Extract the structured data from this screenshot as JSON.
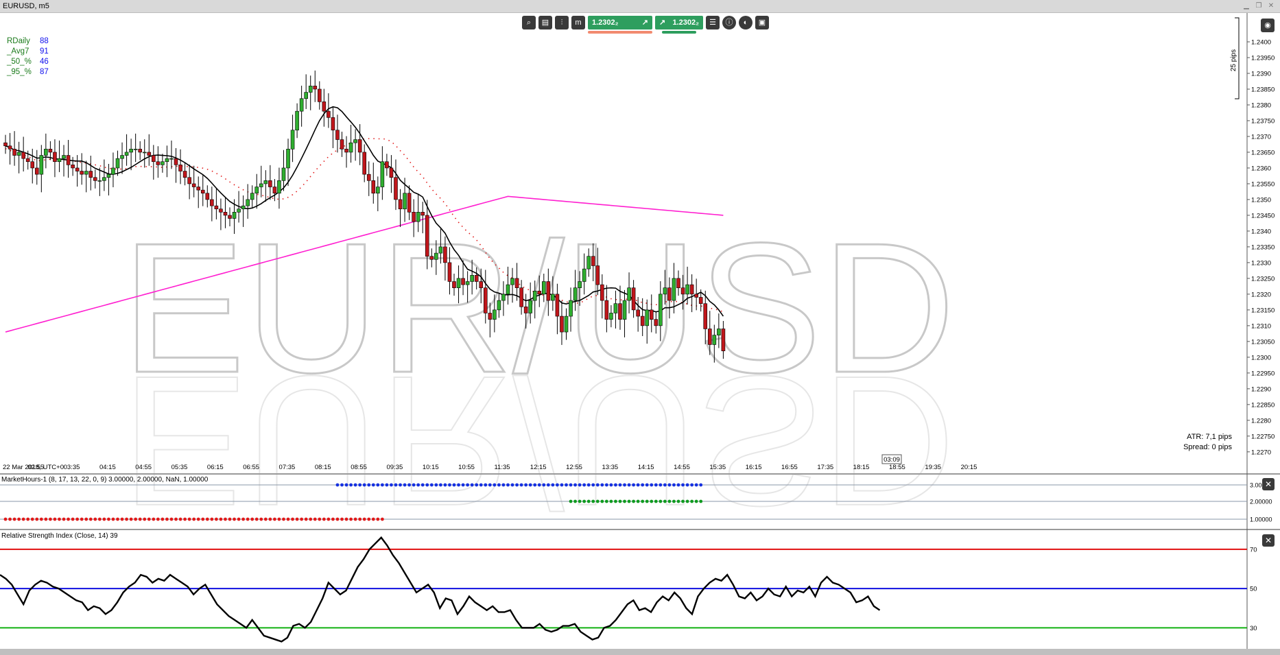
{
  "window": {
    "title": "EURUSD, m5"
  },
  "toolbar": {
    "sell_price": "1.2302₂",
    "buy_price": "1.2302₂",
    "icons": [
      "zoom-icon",
      "chart-settings-icon",
      "indicators-icon",
      "period-icon",
      "list-icon",
      "info-icon",
      "theme-icon",
      "screenshot-icon"
    ]
  },
  "stats": [
    {
      "label": "RDaily",
      "value": "88"
    },
    {
      "label": "_Avg7",
      "value": "91"
    },
    {
      "label": "_50_%",
      "value": "46"
    },
    {
      "label": "_95_%",
      "value": "87"
    }
  ],
  "atr": "ATR: 7,1 pips",
  "spread": "Spread: 0 pips",
  "pips_label": "25 pips",
  "watermark": "EUR/USD",
  "current_time": "03:09",
  "colors": {
    "bull": "#2fae2f",
    "bear": "#c0161b",
    "ma_fast": "#000000",
    "ma_dotted": "#e21a1a",
    "ma_slow": "#ff1fd0",
    "rsi_hi": "#e01010",
    "rsi_mid": "#1010e0",
    "rsi_lo": "#10b010",
    "mh_blue": "#1530e0",
    "mh_green": "#0f9a1f",
    "mh_red": "#e01a1a"
  },
  "chart_data": [
    {
      "type": "candlestick",
      "title": "EURUSD, m5",
      "x_tick_labels": [
        "22 Mar 2018, UTC+0",
        "02:55",
        "03:35",
        "04:15",
        "04:55",
        "05:35",
        "06:15",
        "06:55",
        "07:35",
        "08:15",
        "08:55",
        "09:35",
        "10:15",
        "10:55",
        "11:35",
        "12:15",
        "12:55",
        "13:35",
        "14:15",
        "14:55",
        "15:35",
        "16:15",
        "16:55",
        "17:35",
        "18:15",
        "18:55",
        "19:35",
        "20:15"
      ],
      "y_tick_labels": [
        "1.2400",
        "1.23950",
        "1.2390",
        "1.23850",
        "1.2380",
        "1.23750",
        "1.2370",
        "1.23650",
        "1.2360",
        "1.23550",
        "1.2350",
        "1.23450",
        "1.2340",
        "1.23350",
        "1.2330",
        "1.23250",
        "1.2320",
        "1.23150",
        "1.2310",
        "1.23050",
        "1.2300",
        "1.22950",
        "1.2290",
        "1.22850",
        "1.2280",
        "1.22750",
        "1.2270"
      ],
      "ylim": [
        1.2268,
        1.2405
      ],
      "bars_per_label": 8,
      "closes": [
        1.2367,
        1.2366,
        1.2364,
        1.2365,
        1.2363,
        1.2362,
        1.236,
        1.2358,
        1.2364,
        1.2366,
        1.2365,
        1.2362,
        1.2363,
        1.2364,
        1.2361,
        1.236,
        1.2359,
        1.2358,
        1.2359,
        1.2357,
        1.2356,
        1.2356,
        1.2357,
        1.2358,
        1.236,
        1.2363,
        1.2364,
        1.2365,
        1.2366,
        1.2366,
        1.2365,
        1.2365,
        1.2364,
        1.2362,
        1.2361,
        1.2362,
        1.2363,
        1.2363,
        1.2361,
        1.2359,
        1.2357,
        1.2355,
        1.2354,
        1.2353,
        1.2352,
        1.235,
        1.2348,
        1.2347,
        1.2346,
        1.2345,
        1.2344,
        1.2346,
        1.2347,
        1.2348,
        1.235,
        1.2352,
        1.2354,
        1.2355,
        1.2356,
        1.2354,
        1.2352,
        1.2356,
        1.236,
        1.2366,
        1.2372,
        1.2378,
        1.2382,
        1.2384,
        1.2386,
        1.2385,
        1.2381,
        1.2378,
        1.2376,
        1.2372,
        1.2369,
        1.2366,
        1.2365,
        1.2368,
        1.2369,
        1.2365,
        1.2358,
        1.2356,
        1.2352,
        1.2354,
        1.2362,
        1.236,
        1.2357,
        1.235,
        1.2347,
        1.2352,
        1.2346,
        1.2343,
        1.2346,
        1.2345,
        1.2332,
        1.2331,
        1.2333,
        1.2335,
        1.233,
        1.2324,
        1.2322,
        1.2325,
        1.2323,
        1.2324,
        1.2326,
        1.2324,
        1.2322,
        1.2314,
        1.2312,
        1.2315,
        1.2318,
        1.232,
        1.2323,
        1.2325,
        1.2322,
        1.2316,
        1.2314,
        1.2318,
        1.2321,
        1.232,
        1.2324,
        1.2318,
        1.232,
        1.2313,
        1.2308,
        1.2313,
        1.2318,
        1.2322,
        1.2324,
        1.2328,
        1.2332,
        1.2329,
        1.2323,
        1.2318,
        1.2312,
        1.2314,
        1.2317,
        1.2312,
        1.2318,
        1.2322,
        1.2315,
        1.2313,
        1.231,
        1.2315,
        1.2312,
        1.231,
        1.232,
        1.2322,
        1.2318,
        1.2325,
        1.2322,
        1.232,
        1.2323,
        1.232,
        1.2319,
        1.2317,
        1.2309,
        1.2304,
        1.2307,
        1.2309,
        1.2302
      ]
    },
    {
      "type": "dot-line",
      "title": "MarketHours-1 (8, 17, 13, 22, 0, 9) 3.00000, 2.00000, NaN, 1.00000",
      "y_tick_labels": [
        "3.00000",
        "2.00000",
        "1.00000"
      ],
      "series": [
        {
          "value": 3.0,
          "start_bar": 74,
          "end_bar": 155
        },
        {
          "value": 2.0,
          "start_bar": 126,
          "end_bar": 155
        },
        {
          "value": 1.0,
          "start_bar": 0,
          "end_bar": 84
        }
      ]
    },
    {
      "type": "line",
      "title": "Relative Strength Index (Close, 14) 39",
      "y_tick_labels": [
        "70",
        "50",
        "30"
      ],
      "ylim": [
        20,
        78
      ],
      "levels": [
        70,
        50,
        30
      ],
      "values": [
        57,
        55,
        52,
        47,
        42,
        49,
        52,
        54,
        53,
        51,
        50,
        48,
        46,
        44,
        43,
        39,
        41,
        40,
        37,
        39,
        43,
        48,
        51,
        53,
        57,
        56,
        53,
        55,
        54,
        57,
        55,
        53,
        51,
        47,
        50,
        52,
        47,
        42,
        39,
        36,
        34,
        32,
        30,
        34,
        30,
        26,
        25,
        24,
        23,
        25,
        31,
        32,
        30,
        33,
        39,
        45,
        53,
        50,
        47,
        49,
        55,
        61,
        65,
        70,
        73,
        76,
        72,
        67,
        63,
        58,
        53,
        48,
        50,
        52,
        48,
        40,
        45,
        44,
        37,
        41,
        46,
        43,
        41,
        39,
        41,
        38,
        38,
        39,
        34,
        30,
        30,
        30,
        32,
        29,
        28,
        29,
        31,
        31,
        32,
        28,
        26,
        24,
        25,
        30,
        31,
        34,
        38,
        42,
        44,
        39,
        40,
        38,
        43,
        46,
        44,
        48,
        45,
        40,
        37,
        46,
        50,
        53,
        55,
        54,
        57,
        52,
        46,
        45,
        48,
        44,
        46,
        50,
        47,
        46,
        51,
        46,
        49,
        48,
        51,
        46,
        53,
        56,
        53,
        52,
        50,
        48,
        43,
        44,
        46,
        41,
        39
      ]
    }
  ]
}
